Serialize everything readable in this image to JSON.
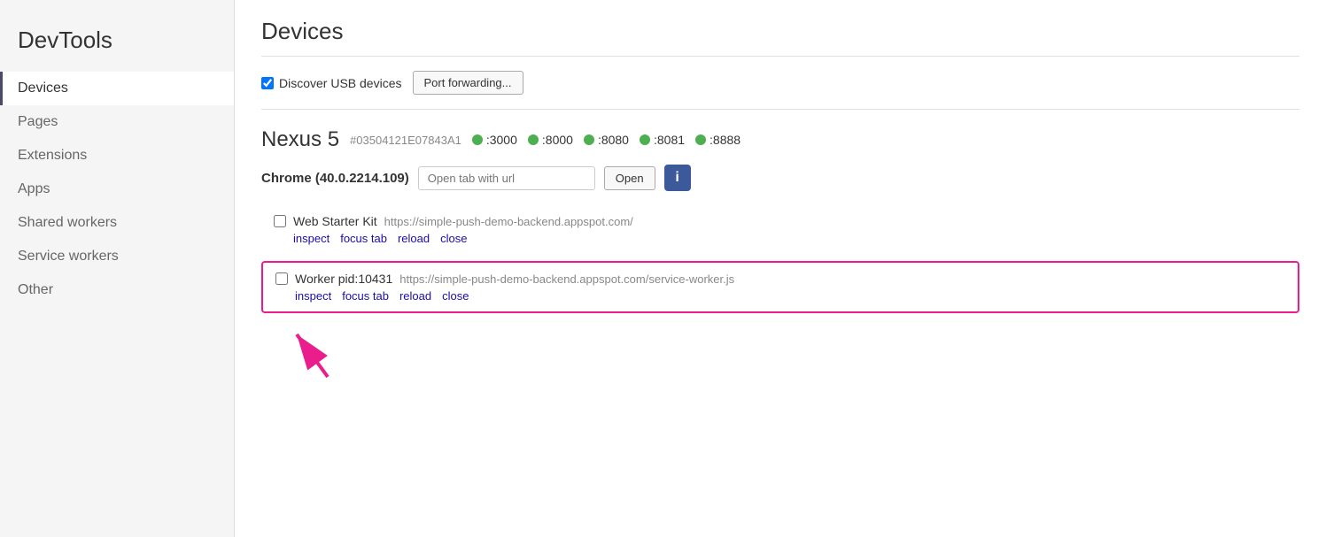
{
  "sidebar": {
    "title": "DevTools",
    "items": [
      {
        "id": "devices",
        "label": "Devices",
        "active": true
      },
      {
        "id": "pages",
        "label": "Pages",
        "active": false
      },
      {
        "id": "extensions",
        "label": "Extensions",
        "active": false
      },
      {
        "id": "apps",
        "label": "Apps",
        "active": false
      },
      {
        "id": "shared-workers",
        "label": "Shared workers",
        "active": false
      },
      {
        "id": "service-workers",
        "label": "Service workers",
        "active": false
      },
      {
        "id": "other",
        "label": "Other",
        "active": false
      }
    ]
  },
  "main": {
    "title": "Devices",
    "toolbar": {
      "discover_usb_label": "Discover USB devices",
      "port_forwarding_label": "Port forwarding..."
    },
    "device": {
      "name": "Nexus 5",
      "id": "#03504121E07843A1",
      "ports": [
        ":3000",
        ":8000",
        ":8080",
        ":8081",
        ":8888"
      ]
    },
    "chrome_section": {
      "label": "Chrome (40.0.2214.109)",
      "url_placeholder": "Open tab with url",
      "open_button": "Open",
      "info_icon_label": "i"
    },
    "tabs": [
      {
        "id": "web-starter-kit",
        "title": "Web Starter Kit",
        "url": "https://simple-push-demo-backend.appspot.com/",
        "actions": [
          "inspect",
          "focus tab",
          "reload",
          "close"
        ],
        "highlighted": false
      },
      {
        "id": "worker-pid",
        "title": "Worker pid:10431",
        "url": "https://simple-push-demo-backend.appspot.com/service-worker.js",
        "actions": [
          "inspect",
          "focus tab",
          "reload",
          "close"
        ],
        "highlighted": true
      }
    ]
  },
  "icons": {
    "info": "i",
    "arrow_color": "#e91e8c"
  }
}
